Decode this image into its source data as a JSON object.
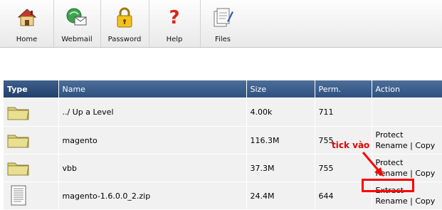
{
  "toolbar": {
    "items": [
      {
        "label": "Home",
        "icon": "home-icon"
      },
      {
        "label": "Webmail",
        "icon": "webmail-icon"
      },
      {
        "label": "Password",
        "icon": "lock-icon"
      },
      {
        "label": "Help",
        "icon": "help-icon"
      },
      {
        "label": "Files",
        "icon": "files-icon"
      }
    ]
  },
  "table": {
    "headers": [
      "Type",
      "Name",
      "Size",
      "Perm.",
      "Action"
    ],
    "rows": [
      {
        "type_icon": "folder-icon",
        "name": "../ Up a Level",
        "size": "4.00k",
        "perm": "711",
        "actions": []
      },
      {
        "type_icon": "folder-icon",
        "name": "magento",
        "size": "116.3M",
        "perm": "755",
        "actions": [
          "Protect",
          "Rename",
          "Copy"
        ]
      },
      {
        "type_icon": "folder-icon",
        "name": "vbb",
        "size": "37.3M",
        "perm": "755",
        "actions": [
          "Protect",
          "Rename",
          "Copy"
        ]
      },
      {
        "type_icon": "document-icon",
        "name": "magento-1.6.0.0_2.zip",
        "size": "24.4M",
        "perm": "644",
        "actions": [
          "Extract",
          "Rename",
          "Copy"
        ]
      }
    ]
  },
  "annotation": {
    "text": "tick vào",
    "color": "#e40000"
  },
  "colors": {
    "header_bg": "#3a5a88",
    "row_bg": "#f1f1f1",
    "annotation": "#ff0000"
  }
}
